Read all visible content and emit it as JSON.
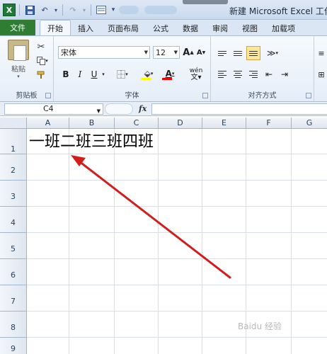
{
  "window": {
    "title": "新建 Microsoft Excel 工作表"
  },
  "quick_access": {
    "excel_icon": "X",
    "save_icon": "save-icon",
    "undo_icon": "↶",
    "redo_icon": "↷",
    "customize_icon": "▾"
  },
  "ribbon_tabs": [
    "文件",
    "开始",
    "插入",
    "页面布局",
    "公式",
    "数据",
    "审阅",
    "视图",
    "加载项"
  ],
  "active_tab": "开始",
  "clipboard_group": {
    "label": "剪贴板",
    "paste_label": "粘贴"
  },
  "font_group": {
    "label": "字体",
    "font_name": "宋体",
    "font_size": "12",
    "bold": "B",
    "italic": "I",
    "underline": "U",
    "grow_font": "A",
    "shrink_font": "A",
    "phonetic": "wén",
    "fill_color": "#ffff00",
    "font_color": "#ff0000"
  },
  "alignment_group": {
    "label": "对齐方式"
  },
  "formula_bar": {
    "name_box": "C4",
    "fx_label": "fx",
    "formula": ""
  },
  "columns": [
    "A",
    "B",
    "C",
    "D",
    "E",
    "F",
    "G"
  ],
  "rows": [
    "1",
    "2",
    "3",
    "4",
    "5",
    "6",
    "7",
    "8",
    "9"
  ],
  "cell_a1": "一班二班三班四班",
  "watermark": "Baidu 经验"
}
